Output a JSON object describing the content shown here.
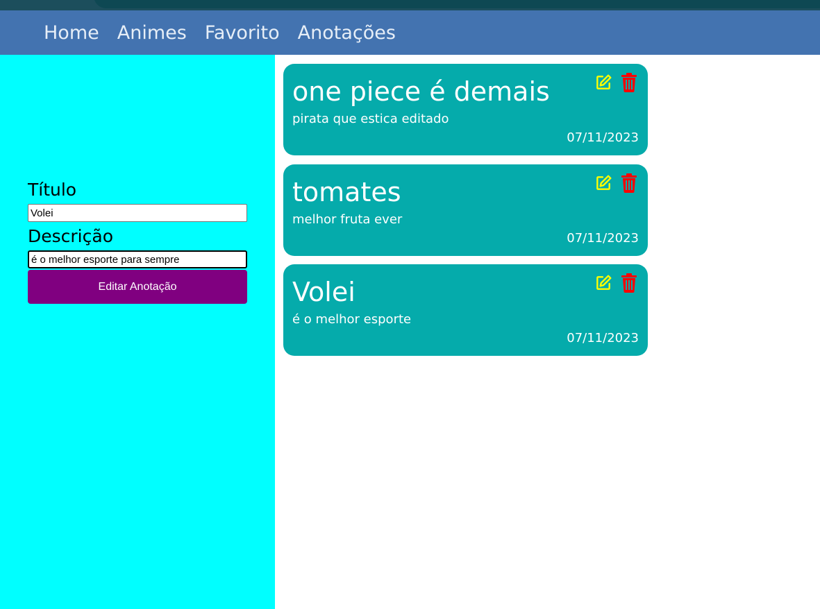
{
  "nav": {
    "items": [
      {
        "label": "Home"
      },
      {
        "label": "Animes"
      },
      {
        "label": "Favorito"
      },
      {
        "label": "Anotações"
      }
    ]
  },
  "form": {
    "title_label": "Título",
    "title_value": "Volei",
    "description_label": "Descrição",
    "description_value": "é o melhor esporte para sempre",
    "submit_label": "Editar Anotação"
  },
  "notes": [
    {
      "title": "one piece é demais",
      "description": "pirata que estica editado",
      "date": "07/11/2023",
      "edit_icon": "edit-icon",
      "delete_icon": "trash-icon"
    },
    {
      "title": "tomates",
      "description": "melhor fruta ever",
      "date": "07/11/2023",
      "edit_icon": "edit-icon",
      "delete_icon": "trash-icon"
    },
    {
      "title": "Volei",
      "description": "é o melhor esporte",
      "date": "07/11/2023",
      "edit_icon": "edit-icon",
      "delete_icon": "trash-icon"
    }
  ],
  "colors": {
    "navbar": "#4373b0",
    "sidebar": "#00ffff",
    "card": "#05abab",
    "button": "#800080",
    "edit_icon": "#ffff00",
    "delete_icon": "#ff0000"
  }
}
